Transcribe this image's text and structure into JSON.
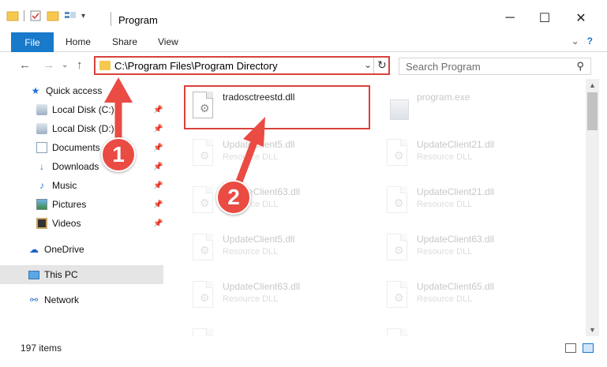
{
  "window": {
    "title": "Program",
    "minimize": "─",
    "maximize": "☐",
    "close": "✕"
  },
  "ribbon": {
    "tabs": [
      "File",
      "Home",
      "Share",
      "View"
    ],
    "collapse_glyph": "⌄",
    "help_glyph": "?"
  },
  "address": {
    "path": "C:\\Program Files\\Program Directory",
    "dropdown_glyph": "⌄",
    "refresh_glyph": "↻"
  },
  "search": {
    "placeholder": "Search Program",
    "icon_glyph": "⚲"
  },
  "nav": {
    "back_glyph": "←",
    "forward_glyph": "→",
    "recent_glyph": "⌄",
    "up_glyph": "↑",
    "items": [
      {
        "label": "Quick access",
        "icon": "star-icon",
        "glyph": "★",
        "pinned": false
      },
      {
        "label": "Local Disk (C:)",
        "icon": "disk-icon",
        "glyph": "",
        "pinned": true
      },
      {
        "label": "Local Disk (D:)",
        "icon": "disk-icon",
        "glyph": "",
        "pinned": true
      },
      {
        "label": "Documents",
        "icon": "documents-icon",
        "glyph": "",
        "pinned": true
      },
      {
        "label": "Downloads",
        "icon": "download-arrow-icon",
        "glyph": "↓",
        "pinned": true
      },
      {
        "label": "Music",
        "icon": "music-note-icon",
        "glyph": "♪",
        "pinned": true
      },
      {
        "label": "Pictures",
        "icon": "pictures-icon",
        "glyph": "",
        "pinned": true
      },
      {
        "label": "Videos",
        "icon": "videos-icon",
        "glyph": "",
        "pinned": true
      },
      {
        "label": "OneDrive",
        "icon": "cloud-icon",
        "glyph": "☁",
        "pinned": false
      },
      {
        "label": "This PC",
        "icon": "computer-icon",
        "glyph": "",
        "pinned": false,
        "selected": true
      },
      {
        "label": "Network",
        "icon": "network-icon",
        "glyph": "⚯",
        "pinned": false
      }
    ],
    "pin_glyph": "📌"
  },
  "files": [
    {
      "name": "tradosctreestd.dll",
      "type": "",
      "icon": "dll-file-icon",
      "highlighted": true,
      "faded": false
    },
    {
      "name": "program.exe",
      "type": "",
      "icon": "exe-file-icon",
      "highlighted": false,
      "faded": true
    },
    {
      "name": "UpdateClient5.dll",
      "type": "Resource DLL",
      "icon": "dll-file-icon",
      "highlighted": false,
      "faded": true
    },
    {
      "name": "UpdateClient21.dll",
      "type": "Resource DLL",
      "icon": "dll-file-icon",
      "highlighted": false,
      "faded": true
    },
    {
      "name": "UpdateClient63.dll",
      "type": "Resource DLL",
      "icon": "dll-file-icon",
      "highlighted": false,
      "faded": true
    },
    {
      "name": "UpdateClient21.dll",
      "type": "Resource DLL",
      "icon": "dll-file-icon",
      "highlighted": false,
      "faded": true
    },
    {
      "name": "UpdateClient5.dll",
      "type": "Resource DLL",
      "icon": "dll-file-icon",
      "highlighted": false,
      "faded": true
    },
    {
      "name": "UpdateClient63.dll",
      "type": "Resource DLL",
      "icon": "dll-file-icon",
      "highlighted": false,
      "faded": true
    },
    {
      "name": "UpdateClient63.dll",
      "type": "Resource DLL",
      "icon": "dll-file-icon",
      "highlighted": false,
      "faded": true
    },
    {
      "name": "UpdateClient65.dll",
      "type": "Resource DLL",
      "icon": "dll-file-icon",
      "highlighted": false,
      "faded": true
    },
    {
      "name": "",
      "type": "",
      "icon": "dll-file-icon",
      "highlighted": false,
      "faded": true
    },
    {
      "name": "",
      "type": "",
      "icon": "dll-file-icon",
      "highlighted": false,
      "faded": true
    }
  ],
  "status": {
    "item_count": "197 items"
  },
  "annotations": {
    "step1": "1",
    "step2": "2"
  },
  "colors": {
    "accent": "#1979ca",
    "annotation_red": "#ea4b43",
    "highlight_border": "#d9413d",
    "selection_bg": "#e5e5e5"
  }
}
